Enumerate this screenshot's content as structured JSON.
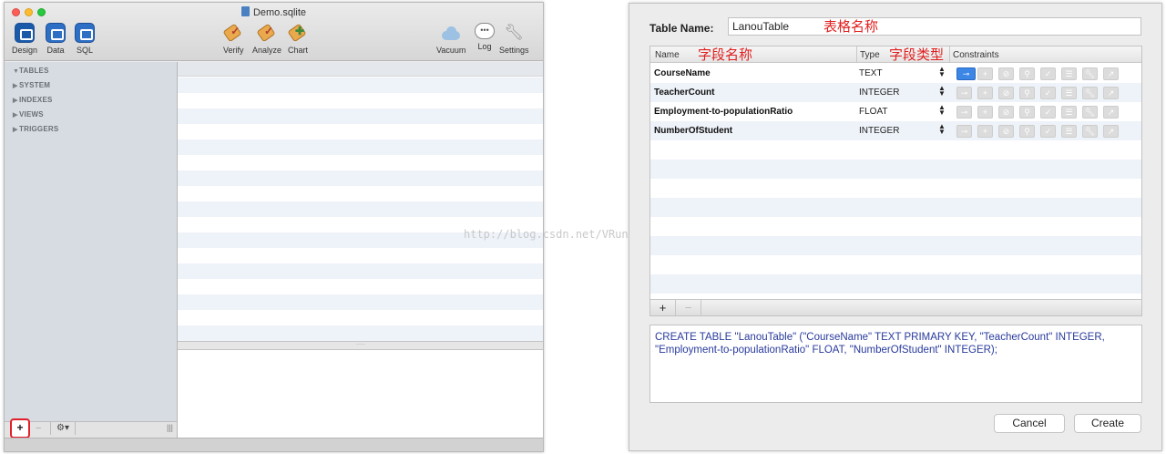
{
  "left_window": {
    "title": "Demo.sqlite",
    "toolbar_left": [
      {
        "label": "Design",
        "icon": "design-icon"
      },
      {
        "label": "Data",
        "icon": "data-icon"
      },
      {
        "label": "SQL",
        "icon": "sql-icon"
      }
    ],
    "toolbar_center": [
      {
        "label": "Verify",
        "icon": "verify-tag-icon"
      },
      {
        "label": "Analyze",
        "icon": "analyze-tag-icon"
      },
      {
        "label": "Chart",
        "icon": "chart-tag-icon"
      }
    ],
    "toolbar_right": [
      {
        "label": "Vacuum",
        "icon": "cloud-icon"
      },
      {
        "label": "Log",
        "icon": "speech-bubble-icon"
      },
      {
        "label": "Settings",
        "icon": "wrench-icon"
      }
    ],
    "sidebar": {
      "items": [
        {
          "label": "TABLES",
          "expanded": true
        },
        {
          "label": "SYSTEM",
          "expanded": false
        },
        {
          "label": "INDEXES",
          "expanded": false
        },
        {
          "label": "VIEWS",
          "expanded": false
        },
        {
          "label": "TRIGGERS",
          "expanded": false
        }
      ],
      "add_label": "+",
      "remove_label": "−",
      "gear_label": "⚙▾",
      "grip_label": "|||"
    },
    "splitter_label": "·····"
  },
  "watermark": "http://blog.csdn.net/VRunSoftYanlz",
  "right_window": {
    "table_name_label": "Table Name:",
    "table_name_value": "LanouTable",
    "annotation_table": "表格名称",
    "columns": {
      "name": "Name",
      "type": "Type",
      "constraints": "Constraints",
      "annotation_name": "字段名称",
      "annotation_type": "字段类型"
    },
    "fields": [
      {
        "name": "CourseName",
        "type": "TEXT",
        "primary_key": true
      },
      {
        "name": "TeacherCount",
        "type": "INTEGER",
        "primary_key": false
      },
      {
        "name": "Employment-to-populationRatio",
        "type": "FLOAT",
        "primary_key": false
      },
      {
        "name": "NumberOfStudent",
        "type": "INTEGER",
        "primary_key": false
      }
    ],
    "add_field_label": "+",
    "remove_field_label": "−",
    "sql": "CREATE TABLE \"LanouTable\" (\"CourseName\" TEXT PRIMARY KEY, \"TeacherCount\" INTEGER, \"Employment-to-populationRatio\" FLOAT, \"NumberOfStudent\" INTEGER);",
    "cancel_label": "Cancel",
    "create_label": "Create"
  },
  "colors": {
    "accent_blue": "#3c86e6",
    "annotation_red": "#e02020",
    "sidebar_bg": "#d7dce3",
    "stripe_blue": "#eef2f9",
    "sql_text": "#283a9c"
  }
}
